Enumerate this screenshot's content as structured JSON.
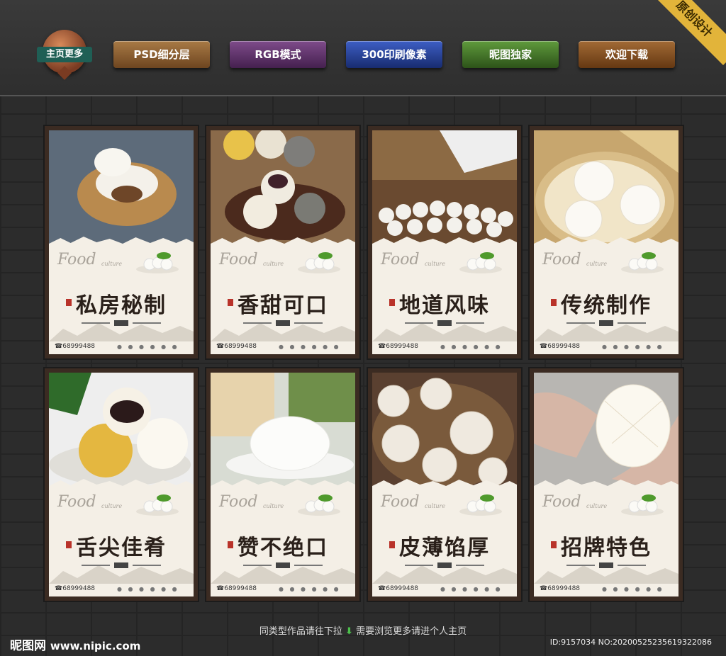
{
  "header": {
    "home_label": "主页更多",
    "tags": [
      {
        "label": "PSD细分层",
        "color": "#8a5a2b"
      },
      {
        "label": "RGB模式",
        "color": "#5a2e63"
      },
      {
        "label": "300印刷像素",
        "color": "#1f3a8a"
      },
      {
        "label": "昵图独家",
        "color": "#3c6b25"
      },
      {
        "label": "欢迎下载",
        "color": "#7a4a1c"
      }
    ],
    "corner_ribbon": "原创设计"
  },
  "posters": [
    {
      "title": "私房秘制",
      "food_label": "Food",
      "culture_label": "culture",
      "phone": "68999488"
    },
    {
      "title": "香甜可口",
      "food_label": "Food",
      "culture_label": "culture",
      "phone": "68999488"
    },
    {
      "title": "地道风味",
      "food_label": "Food",
      "culture_label": "culture",
      "phone": "68999488"
    },
    {
      "title": "传统制作",
      "food_label": "Food",
      "culture_label": "culture",
      "phone": "68999488"
    },
    {
      "title": "舌尖佳肴",
      "food_label": "Food",
      "culture_label": "culture",
      "phone": "68999488"
    },
    {
      "title": "赞不绝口",
      "food_label": "Food",
      "culture_label": "culture",
      "phone": "68999488"
    },
    {
      "title": "皮薄馅厚",
      "food_label": "Food",
      "culture_label": "culture",
      "phone": "68999488"
    },
    {
      "title": "招牌特色",
      "food_label": "Food",
      "culture_label": "culture",
      "phone": "68999488"
    }
  ],
  "footer": {
    "hint_left": "同类型作品请往下拉",
    "hint_arrow": "⬇",
    "hint_right": "需要浏览更多请进个人主页",
    "brand": "昵图网",
    "brand_url": "www.nipic.com",
    "image_id": "ID:9157034 NO:20200525235619322086"
  }
}
